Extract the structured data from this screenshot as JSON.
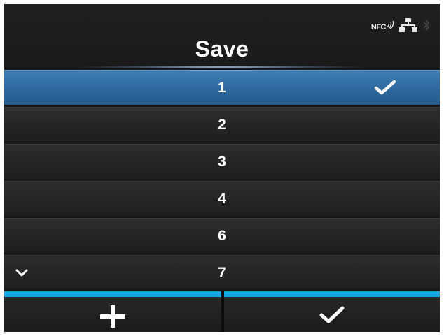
{
  "status_bar": {
    "nfc_label": "NFC",
    "icons": [
      "nfc-icon",
      "wired-network-icon",
      "bluetooth-icon"
    ]
  },
  "header": {
    "title": "Save"
  },
  "list": {
    "items": [
      {
        "label": "1",
        "selected": true,
        "checked": true
      },
      {
        "label": "2",
        "selected": false,
        "checked": false
      },
      {
        "label": "3",
        "selected": false,
        "checked": false
      },
      {
        "label": "4",
        "selected": false,
        "checked": false
      },
      {
        "label": "6",
        "selected": false,
        "checked": false
      },
      {
        "label": "7",
        "selected": false,
        "checked": false
      }
    ],
    "more_below_icon": "chevron-down-icon"
  },
  "buttons": {
    "add_icon": "plus-icon",
    "confirm_icon": "checkmark-icon"
  },
  "colors": {
    "selected_row": "#2f6aa0",
    "accent": "#1aa3e0",
    "background": "#161616"
  }
}
